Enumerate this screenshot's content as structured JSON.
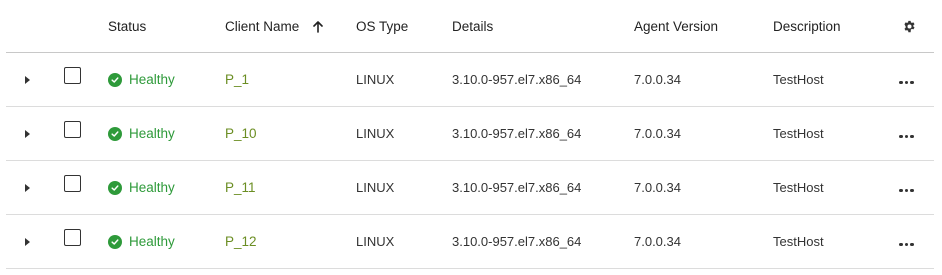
{
  "header": {
    "status": "Status",
    "client_name": "Client Name",
    "os_type": "OS Type",
    "details": "Details",
    "agent_version": "Agent Version",
    "description": "Description",
    "sort_icon": "arrow-up-icon",
    "settings_icon": "gear-icon"
  },
  "rows": [
    {
      "status": "Healthy",
      "name": "P_1",
      "os": "LINUX",
      "details": "3.10.0-957.el7.x86_64",
      "agent": "7.0.0.34",
      "description": "TestHost"
    },
    {
      "status": "Healthy",
      "name": "P_10",
      "os": "LINUX",
      "details": "3.10.0-957.el7.x86_64",
      "agent": "7.0.0.34",
      "description": "TestHost"
    },
    {
      "status": "Healthy",
      "name": "P_11",
      "os": "LINUX",
      "details": "3.10.0-957.el7.x86_64",
      "agent": "7.0.0.34",
      "description": "TestHost"
    },
    {
      "status": "Healthy",
      "name": "P_12",
      "os": "LINUX",
      "details": "3.10.0-957.el7.x86_64",
      "agent": "7.0.0.34",
      "description": "TestHost"
    }
  ],
  "colors": {
    "healthy": "#2e9a3a",
    "link": "#6b8e23",
    "border": "#dcdcdc"
  }
}
